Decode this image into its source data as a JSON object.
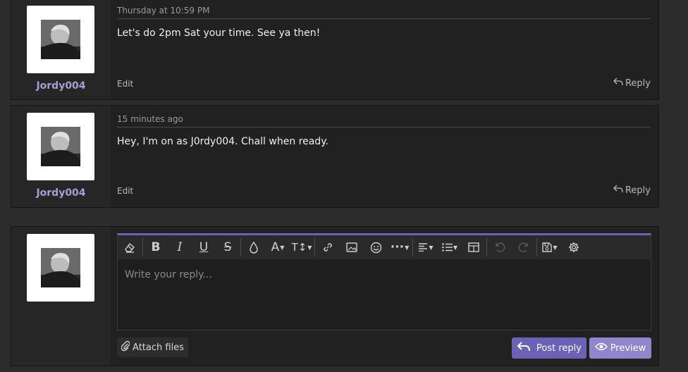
{
  "posts": [
    {
      "username": "Jordy004",
      "date": "Thursday at 10:59 PM",
      "text": "Let's do 2pm Sat your time. See ya then!",
      "edit_label": "Edit",
      "reply_label": "Reply"
    },
    {
      "username": "Jordy004",
      "date": "15 minutes ago",
      "text": "Hey, I'm on as J0rdy004. Chall when ready.",
      "edit_label": "Edit",
      "reply_label": "Reply"
    }
  ],
  "editor": {
    "placeholder": "Write your reply...",
    "toolbar": [
      "eraser-icon",
      "bold-icon",
      "italic-icon",
      "underline-icon",
      "strikethrough-icon",
      "text-color-icon",
      "font-family-icon",
      "font-size-icon",
      "link-icon",
      "image-icon",
      "emoji-icon",
      "more-icon",
      "align-icon",
      "list-icon",
      "table-icon",
      "undo-icon",
      "redo-icon",
      "drafts-icon",
      "settings-icon"
    ]
  },
  "actions": {
    "attach_label": "Attach files",
    "post_reply_label": "Post reply",
    "preview_label": "Preview"
  },
  "colors": {
    "accent": "#6b62b5",
    "username": "#a59fd6",
    "background": "#2c2c2c",
    "post_bg": "#212121"
  }
}
